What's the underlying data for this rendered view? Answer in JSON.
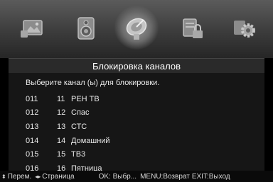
{
  "menu_icons": [
    {
      "icon": "picture-settings-icon",
      "active": false
    },
    {
      "icon": "sound-settings-icon",
      "active": false
    },
    {
      "icon": "channel-settings-icon",
      "active": true
    },
    {
      "icon": "lock-settings-icon",
      "active": false
    },
    {
      "icon": "setup-gear-icon",
      "active": false
    }
  ],
  "title": "Блокировка каналов",
  "prompt": "Выберите канал (ы) для блокировки.",
  "channels": [
    {
      "code": "011",
      "number": "11",
      "name": "РЕН ТВ"
    },
    {
      "code": "012",
      "number": "12",
      "name": "Спас"
    },
    {
      "code": "013",
      "number": "13",
      "name": "СТС"
    },
    {
      "code": "014",
      "number": "14",
      "name": "Домашний"
    },
    {
      "code": "015",
      "number": "15",
      "name": "ТВ3"
    },
    {
      "code": "016",
      "number": "16",
      "name": "Пятница"
    }
  ],
  "footer": {
    "move": "Перем.",
    "page": "Страница",
    "ok": "OK: Выбр...",
    "menu": "MENU:Возврат",
    "exit": "EXIT:Выход"
  }
}
